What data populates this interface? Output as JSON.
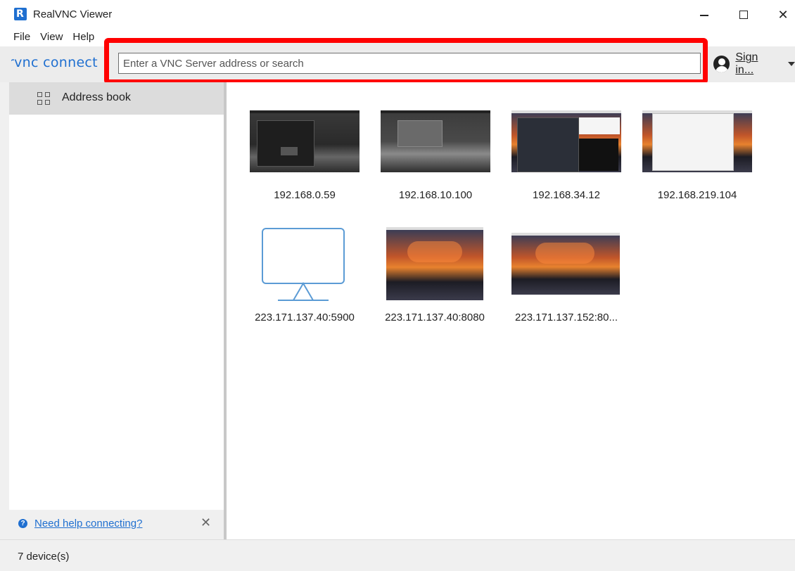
{
  "window": {
    "title": "RealVNC Viewer",
    "app_icon_glyph": "R"
  },
  "menu": [
    "File",
    "View",
    "Help"
  ],
  "toolbar": {
    "brand": "RVNC CONNECT",
    "search_placeholder": "Enter a VNC Server address or search",
    "search_value": "",
    "sign_in_label": "Sign in..."
  },
  "sidebar": {
    "items": [
      {
        "label": "Address book",
        "icon": "grid-icon",
        "selected": true
      }
    ],
    "help_link": "Need help connecting?"
  },
  "devices": [
    {
      "label": "192.168.0.59",
      "thumbnail": "dark-desktop"
    },
    {
      "label": "192.168.10.100",
      "thumbnail": "dark-desktop"
    },
    {
      "label": "192.168.34.12",
      "thumbnail": "sunset-desktop-terminal"
    },
    {
      "label": "192.168.219.104",
      "thumbnail": "sunset-desktop-window"
    },
    {
      "label": "223.171.137.40:5900",
      "thumbnail": "monitor-icon"
    },
    {
      "label": "223.171.137.40:8080",
      "thumbnail": "sunset-desktop"
    },
    {
      "label": "223.171.137.152:80...",
      "thumbnail": "sunset-desktop"
    }
  ],
  "status": {
    "text": "7 device(s)"
  },
  "colors": {
    "accent": "#1f6fd0",
    "highlight": "#ff0000"
  }
}
